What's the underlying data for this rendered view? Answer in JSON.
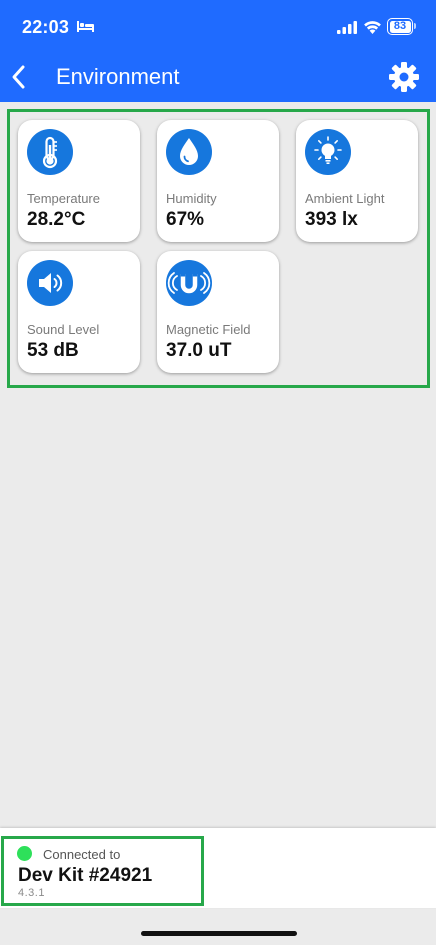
{
  "status_bar": {
    "time": "22:03",
    "battery": "83"
  },
  "header": {
    "title": "Environment"
  },
  "sensors": [
    {
      "label": "Temperature",
      "value": "28.2°C",
      "icon": "thermometer-icon"
    },
    {
      "label": "Humidity",
      "value": "67%",
      "icon": "water-drop-icon"
    },
    {
      "label": "Ambient Light",
      "value": "393 lx",
      "icon": "lightbulb-icon"
    },
    {
      "label": "Sound Level",
      "value": "53 dB",
      "icon": "speaker-icon"
    },
    {
      "label": "Magnetic Field",
      "value": "37.0 uT",
      "icon": "magnet-icon"
    }
  ],
  "connection": {
    "status": "Connected to",
    "device": "Dev Kit #24921",
    "version": "4.3.1",
    "status_color": "#2ee05a"
  },
  "colors": {
    "header": "#1f6bff",
    "icon_bg": "#1677dd",
    "highlight": "#27a84a"
  }
}
